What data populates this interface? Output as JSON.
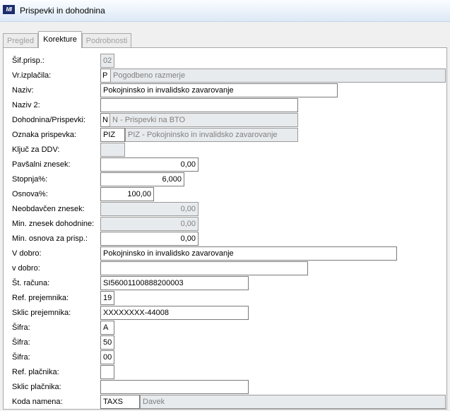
{
  "window": {
    "title": "Prispevki in dohodnina",
    "logo": "MI"
  },
  "tabs": [
    {
      "label": "Pregled"
    },
    {
      "label": "Korekture"
    },
    {
      "label": "Podrobnosti"
    }
  ],
  "form": {
    "sif_prisp": {
      "label": "Šif.prisp.:",
      "value": "02"
    },
    "vr_izplacila": {
      "label": "Vr.izplačila:",
      "code": "P",
      "desc": "Pogodbeno razmerje"
    },
    "naziv": {
      "label": "Naziv:",
      "value": "Pokojninsko in invalidsko zavarovanje"
    },
    "naziv2": {
      "label": "Naziv 2:",
      "value": ""
    },
    "dohodnina": {
      "label": "Dohodnina/Prispevki:",
      "code": "N",
      "desc": "N - Prispevki na BTO"
    },
    "oznaka": {
      "label": "Oznaka prispevka:",
      "code": "PIZ",
      "desc": "PIZ - Pokojninsko in invalidsko zavarovanje"
    },
    "kljuc_ddv": {
      "label": "Ključ za DDV:",
      "value": ""
    },
    "pavsalni": {
      "label": "Pavšalni znesek:",
      "value": "0,00"
    },
    "stopnja": {
      "label": "Stopnja%:",
      "value": "6,000"
    },
    "osnova": {
      "label": "Osnova%:",
      "value": "100,00"
    },
    "neobdavcen": {
      "label": "Neobdavčen znesek:",
      "value": "0,00"
    },
    "min_dohodnine": {
      "label": "Min. znesek dohodnine:",
      "value": "0,00"
    },
    "min_osnova": {
      "label": "Min. osnova za prisp.:",
      "value": "0,00"
    },
    "v_dobro": {
      "label": "V dobro:",
      "value": "Pokojninsko in invalidsko zavarovanje"
    },
    "v_dobro2": {
      "label": "v dobro:",
      "value": ""
    },
    "st_racuna": {
      "label": "Št. računa:",
      "value": "SI56001100888200003"
    },
    "ref_prejemnika": {
      "label": "Ref. prejemnika:",
      "value": "19"
    },
    "sklic_prejemnika": {
      "label": "Sklic prejemnika:",
      "value": "XXXXXXXX-44008"
    },
    "sifra1": {
      "label": "Šifra:",
      "value": "A"
    },
    "sifra2": {
      "label": "Šifra:",
      "value": "50"
    },
    "sifra3": {
      "label": "Šifra:",
      "value": "00"
    },
    "ref_placnika": {
      "label": "Ref. plačnika:",
      "value": ""
    },
    "sklic_placnika": {
      "label": "Sklic plačnika:",
      "value": ""
    },
    "koda_namena": {
      "label": "Koda namena:",
      "code": "TAXS",
      "desc": "Davek"
    }
  }
}
